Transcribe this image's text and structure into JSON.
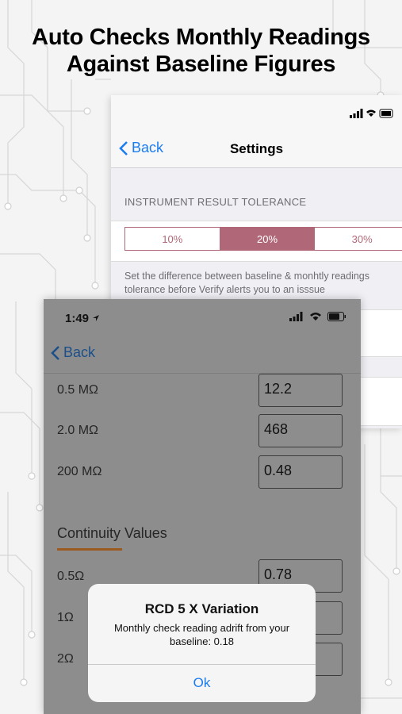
{
  "headline": {
    "line1": "Auto Checks Monthly Readings",
    "line2": "Against Baseline Figures"
  },
  "settings_screen": {
    "back_label": "Back",
    "title": "Settings",
    "section_header": "INSTRUMENT RESULT  TOLERANCE",
    "tolerance_options": [
      "10%",
      "20%",
      "30%"
    ],
    "selected_tolerance": "20%",
    "note_line1": "Set the difference between baseline & monhtly readings",
    "note_line2": "tolerance before Verify alerts you to an isssue"
  },
  "readings_screen": {
    "time": "1:49",
    "back_label": "Back",
    "insulation_rows": [
      {
        "label": "0.5 MΩ",
        "value": "12.2"
      },
      {
        "label": "2.0 MΩ",
        "value": "468"
      },
      {
        "label": "200 MΩ",
        "value": "0.48"
      }
    ],
    "continuity_title": "Continuity Values",
    "continuity_rows": [
      {
        "label": "0.5Ω",
        "value": "0.78"
      },
      {
        "label": "1Ω",
        "value": ""
      },
      {
        "label": "2Ω",
        "value": ""
      }
    ]
  },
  "alert": {
    "title": "RCD 5 X Variation",
    "message_line1": "Monthly check reading adrift from your",
    "message_line2": "baseline: 0.18",
    "ok_label": "Ok"
  },
  "colors": {
    "accent_blue": "#1a7cf0",
    "segment_pink": "#b06878",
    "continuity_underline": "#9a5a20"
  }
}
